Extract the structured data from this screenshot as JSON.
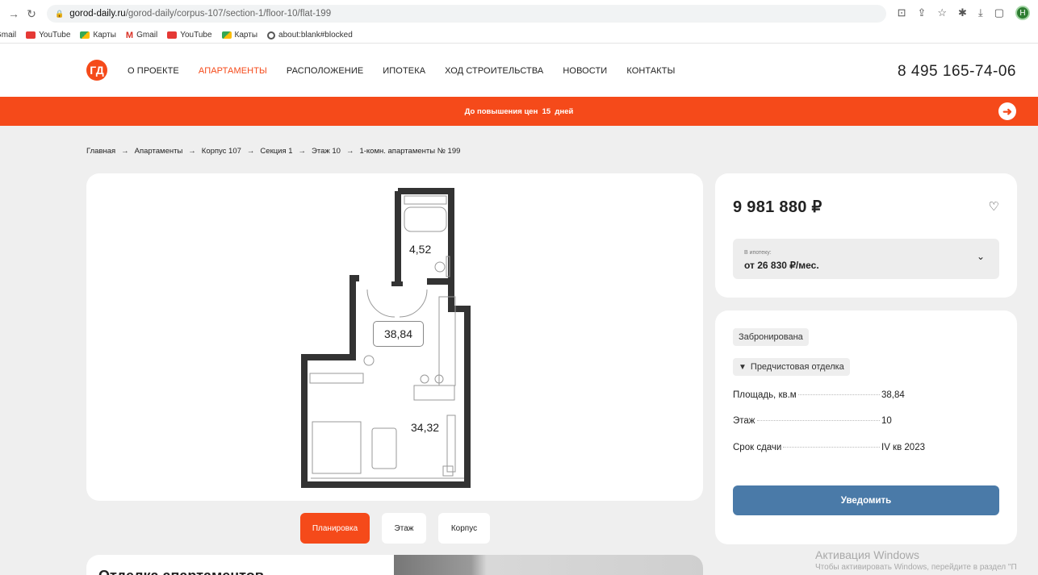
{
  "browser": {
    "url_host": "gorod-daily.ru",
    "url_path": "/gorod-daily/corpus-107/section-1/floor-10/flat-199",
    "avatar_letter": "H",
    "bookmarks": [
      "Gmail",
      "YouTube",
      "Карты",
      "Gmail",
      "YouTube",
      "Карты",
      "about:blank#blocked"
    ]
  },
  "header": {
    "logo": "ГД",
    "nav": [
      "О ПРОЕКТЕ",
      "АПАРТАМЕНТЫ",
      "РАСПОЛОЖЕНИЕ",
      "ИПОТЕКА",
      "ХОД СТРОИТЕЛЬСТВА",
      "НОВОСТИ",
      "КОНТАКТЫ"
    ],
    "active_nav": "АПАРТАМЕНТЫ",
    "phone": "8 495 165-74-06"
  },
  "promo": {
    "text": "До повышения цен  15  дней"
  },
  "breadcrumb": [
    "Главная",
    "Апартаменты",
    "Корпус 107",
    "Секция 1",
    "Этаж 10",
    "1-комн. апартаменты № 199"
  ],
  "plan": {
    "areas": {
      "bathroom": "4,52",
      "total": "38,84",
      "room": "34,32"
    }
  },
  "tabs": [
    "Планировка",
    "Этаж",
    "Корпус"
  ],
  "bottom": {
    "title": "Отделка апартаментов"
  },
  "price_card": {
    "price": "9 981 880 ₽",
    "mortgage_caption": "В ипотеку:",
    "mortgage_value": "от 26 830 ₽/мес."
  },
  "info_card": {
    "status": "Забронирована",
    "finish": "Предчистовая отделка",
    "rows": [
      {
        "label": "Площадь, кв.м",
        "value": "38,84"
      },
      {
        "label": "Этаж",
        "value": "10"
      },
      {
        "label": "Срок сдачи",
        "value": "IV кв 2023"
      }
    ],
    "notify_label": "Уведомить"
  },
  "watermark": {
    "line1": "Активация Windows",
    "line2": "Чтобы активировать Windows, перейдите в раздел \"П"
  },
  "colors": {
    "accent": "#f54a1a",
    "button_blue": "#4a7aa8"
  }
}
